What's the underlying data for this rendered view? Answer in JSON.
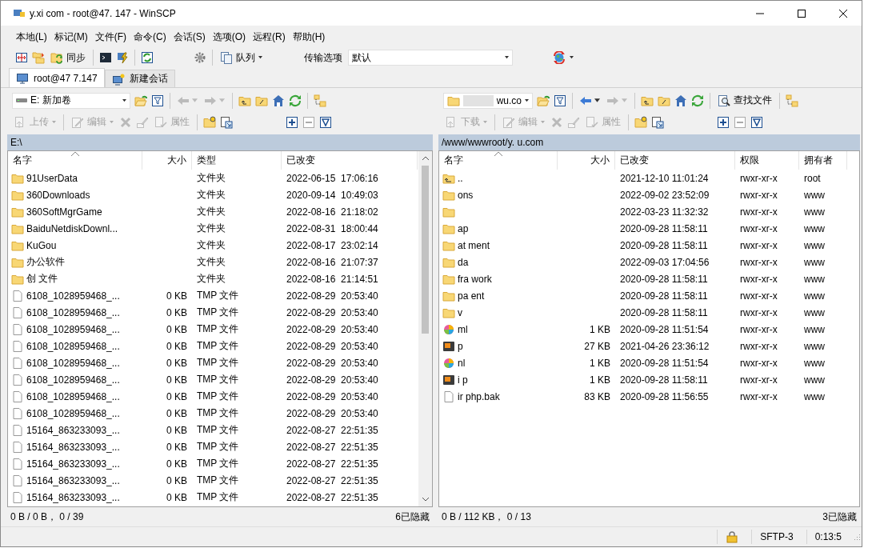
{
  "window": {
    "title": "y.xi com - root@47. 147 - WinSCP"
  },
  "menu": [
    "本地(L)",
    "标记(M)",
    "文件(F)",
    "命令(C)",
    "会话(S)",
    "选项(O)",
    "远程(R)",
    "帮助(H)"
  ],
  "toolbar": {
    "sync_label": "同步",
    "queue_label": "队列",
    "transfer_label": "传输选项",
    "transfer_value": "默认"
  },
  "tabs": [
    {
      "label": "root@47 7.147",
      "selected": true
    },
    {
      "label": "新建会话",
      "selected": false
    }
  ],
  "left": {
    "drive": "E: 新加卷",
    "nav": [
      {
        "kind": "back",
        "disabled": true
      },
      {
        "kind": "forward",
        "disabled": true
      }
    ],
    "actions": [
      {
        "label": "上传",
        "disabled": true
      },
      {
        "label": "编辑",
        "disabled": true
      },
      {
        "label": "属性",
        "disabled": true
      }
    ],
    "path": "E:\\",
    "columns": [
      {
        "label": "名字",
        "sorted": true
      },
      {
        "label": "大小",
        "sorted": false
      },
      {
        "label": "类型",
        "sorted": false
      },
      {
        "label": "已改变",
        "sorted": false
      }
    ],
    "rows": [
      {
        "kind": "folder",
        "name": "91UserData",
        "type": "文件夹",
        "changed": "2022-06-15  17:06:16"
      },
      {
        "kind": "folder",
        "name": "360Downloads",
        "type": "文件夹",
        "changed": "2020-09-14  10:49:03"
      },
      {
        "kind": "folder",
        "name": "360SoftMgrGame",
        "type": "文件夹",
        "changed": "2022-08-16  21:18:02"
      },
      {
        "kind": "folder",
        "name": "BaiduNetdiskDownl...",
        "type": "文件夹",
        "changed": "2022-08-31  18:00:44"
      },
      {
        "kind": "folder",
        "name": "KuGou",
        "type": "文件夹",
        "changed": "2022-08-17  23:02:14"
      },
      {
        "kind": "folder",
        "name": "办公软件",
        "type": "文件夹",
        "changed": "2022-08-16  21:07:37"
      },
      {
        "kind": "folder",
        "name": "创 文件",
        "type": "文件夹",
        "changed": "2022-08-16  21:14:51"
      },
      {
        "kind": "file",
        "name": "6108_1028959468_...",
        "size": "0 KB",
        "type": "TMP 文件",
        "changed": "2022-08-29  20:53:40"
      },
      {
        "kind": "file",
        "name": "6108_1028959468_...",
        "size": "0 KB",
        "type": "TMP 文件",
        "changed": "2022-08-29  20:53:40"
      },
      {
        "kind": "file",
        "name": "6108_1028959468_...",
        "size": "0 KB",
        "type": "TMP 文件",
        "changed": "2022-08-29  20:53:40"
      },
      {
        "kind": "file",
        "name": "6108_1028959468_...",
        "size": "0 KB",
        "type": "TMP 文件",
        "changed": "2022-08-29  20:53:40"
      },
      {
        "kind": "file",
        "name": "6108_1028959468_...",
        "size": "0 KB",
        "type": "TMP 文件",
        "changed": "2022-08-29  20:53:40"
      },
      {
        "kind": "file",
        "name": "6108_1028959468_...",
        "size": "0 KB",
        "type": "TMP 文件",
        "changed": "2022-08-29  20:53:40"
      },
      {
        "kind": "file",
        "name": "6108_1028959468_...",
        "size": "0 KB",
        "type": "TMP 文件",
        "changed": "2022-08-29  20:53:40"
      },
      {
        "kind": "file",
        "name": "6108_1028959468_...",
        "size": "0 KB",
        "type": "TMP 文件",
        "changed": "2022-08-29  20:53:40"
      },
      {
        "kind": "file",
        "name": "15164_863233093_...",
        "size": "0 KB",
        "type": "TMP 文件",
        "changed": "2022-08-27  22:51:35"
      },
      {
        "kind": "file",
        "name": "15164_863233093_...",
        "size": "0 KB",
        "type": "TMP 文件",
        "changed": "2022-08-27  22:51:35"
      },
      {
        "kind": "file",
        "name": "15164_863233093_...",
        "size": "0 KB",
        "type": "TMP 文件",
        "changed": "2022-08-27  22:51:35"
      },
      {
        "kind": "file",
        "name": "15164_863233093_...",
        "size": "0 KB",
        "type": "TMP 文件",
        "changed": "2022-08-27  22:51:35"
      },
      {
        "kind": "file",
        "name": "15164_863233093_...",
        "size": "0 KB",
        "type": "TMP 文件",
        "changed": "2022-08-27  22:51:35"
      }
    ],
    "status": "0 B / 0 B， 0 / 39",
    "hidden": "6已隐藏"
  },
  "right": {
    "location": "wu.co",
    "find_label": "查找文件",
    "nav": [
      {
        "kind": "back",
        "disabled": false
      },
      {
        "kind": "forward",
        "disabled": true
      }
    ],
    "actions": [
      {
        "label": "下载",
        "disabled": true
      },
      {
        "label": "编辑",
        "disabled": true
      },
      {
        "label": "属性",
        "disabled": true
      }
    ],
    "path": "/www/wwwroot/y. u.com",
    "columns": [
      {
        "label": "名字",
        "sorted": true
      },
      {
        "label": "大小",
        "sorted": false
      },
      {
        "label": "已改变",
        "sorted": false
      },
      {
        "label": "权限",
        "sorted": false
      },
      {
        "label": "拥有者",
        "sorted": false
      }
    ],
    "rows": [
      {
        "kind": "parent",
        "name": "..",
        "changed": "2021-12-10 11:01:24",
        "rights": "rwxr-xr-x",
        "owner": "root"
      },
      {
        "kind": "folder",
        "name": "ons",
        "changed": "2022-09-02 23:52:09",
        "rights": "rwxr-xr-x",
        "owner": "www"
      },
      {
        "kind": "folder",
        "changed": "2022-03-23 11:32:32",
        "rights": "rwxr-xr-x",
        "owner": "www"
      },
      {
        "kind": "folder",
        "name": "ap",
        "changed": "2020-09-28 11:58:11",
        "rights": "rwxr-xr-x",
        "owner": "www"
      },
      {
        "kind": "folder",
        "name": "at ment",
        "changed": "2020-09-28 11:58:11",
        "rights": "rwxr-xr-x",
        "owner": "www"
      },
      {
        "kind": "folder",
        "name": "da",
        "changed": "2022-09-03 17:04:56",
        "rights": "rwxr-xr-x",
        "owner": "www"
      },
      {
        "kind": "folder",
        "name": "fra work",
        "changed": "2020-09-28 11:58:11",
        "rights": "rwxr-xr-x",
        "owner": "www"
      },
      {
        "kind": "folder",
        "name": "pa ent",
        "changed": "2020-09-28 11:58:11",
        "rights": "rwxr-xr-x",
        "owner": "www"
      },
      {
        "kind": "folder",
        "name": "v",
        "changed": "2020-09-28 11:58:11",
        "rights": "rwxr-xr-x",
        "owner": "www"
      },
      {
        "kind": "web",
        "name": "ml",
        "size": "1 KB",
        "changed": "2020-09-28 11:51:54",
        "rights": "rwxr-xr-x",
        "owner": "www"
      },
      {
        "kind": "php",
        "name": "p",
        "size": "27 KB",
        "changed": "2021-04-26 23:36:12",
        "rights": "rwxr-xr-x",
        "owner": "www"
      },
      {
        "kind": "web",
        "name": "nl",
        "size": "1 KB",
        "changed": "2020-09-28 11:51:54",
        "rights": "rwxr-xr-x",
        "owner": "www"
      },
      {
        "kind": "php",
        "name": "i p",
        "size": "1 KB",
        "changed": "2020-09-28 11:58:11",
        "rights": "rwxr-xr-x",
        "owner": "www"
      },
      {
        "kind": "file",
        "name": "ir php.bak",
        "size": "83 KB",
        "changed": "2020-09-28 11:56:55",
        "rights": "rwxr-xr-x",
        "owner": "www"
      }
    ],
    "status": "0 B / 112 KB， 0 / 13",
    "hidden": "3已隐藏"
  },
  "status_bar": {
    "protocol": "SFTP-3",
    "time": "0:13:5"
  }
}
